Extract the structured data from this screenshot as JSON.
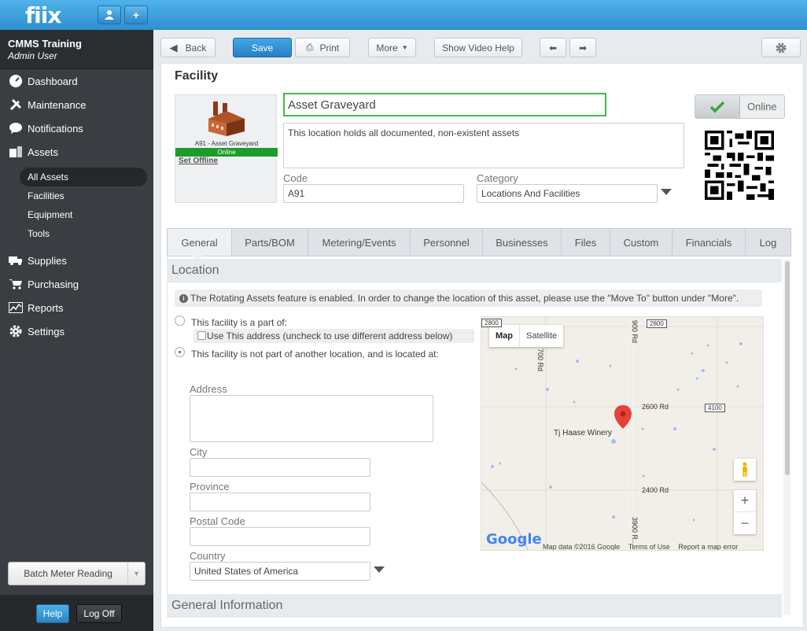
{
  "app": {
    "logo": "fiix"
  },
  "account": {
    "company": "CMMS Training",
    "role": "Admin User"
  },
  "nav": {
    "items": [
      {
        "label": "Dashboard",
        "icon": "dashboard-icon"
      },
      {
        "label": "Maintenance",
        "icon": "tools-icon"
      },
      {
        "label": "Notifications",
        "icon": "chat-bubble-icon"
      },
      {
        "label": "Assets",
        "icon": "boxes-icon"
      },
      {
        "label": "Supplies",
        "icon": "truck-icon"
      },
      {
        "label": "Purchasing",
        "icon": "cart-icon"
      },
      {
        "label": "Reports",
        "icon": "chart-icon"
      },
      {
        "label": "Settings",
        "icon": "gear-icon"
      }
    ],
    "asset_subitems": [
      "All Assets",
      "Facilities",
      "Equipment",
      "Tools"
    ],
    "batch_label": "Batch Meter Reading",
    "help_label": "Help",
    "logoff_label": "Log Off"
  },
  "toolbar": {
    "back": "Back",
    "save": "Save",
    "print": "Print",
    "more": "More",
    "video_help": "Show Video Help"
  },
  "record": {
    "type_title": "Facility",
    "name": "Asset Graveyard",
    "description": "This location holds all documented, non-existent assets",
    "thumb_caption": "A91 - Asset Graveyard",
    "thumb_status": "Online",
    "set_offline": "Set Offline",
    "code_label": "Code",
    "code": "A91",
    "category_label": "Category",
    "category": "Locations And Facilities",
    "status_toggle": "Online"
  },
  "tabs": [
    "General",
    "Parts/BOM",
    "Metering/Events",
    "Personnel",
    "Businesses",
    "Files",
    "Custom",
    "Financials",
    "Log"
  ],
  "location": {
    "heading": "Location",
    "notice": "The Rotating Assets feature is enabled. In order to change the location of this asset, please use the \"Move To\" button under \"More\".",
    "option_part_of": "This facility is a part of:",
    "use_address": "Use This address (uncheck to use different address below)",
    "option_not_part": "This facility is not part of another location, and is located at:",
    "address_label": "Address",
    "city_label": "City",
    "province_label": "Province",
    "postal_label": "Postal Code",
    "country_label": "Country",
    "country": "United States of America"
  },
  "map": {
    "type_map": "Map",
    "type_satellite": "Satellite",
    "place": "Tj Haase Winery",
    "roads": {
      "r2800a": "2800",
      "r2800b": "2800",
      "r700": "700 Rd",
      "r900": "900 Rd",
      "r2600": "2600 Rd",
      "r4100": "4100",
      "r2400": "2400 Rd",
      "r3900": "3900 R..."
    },
    "brand": "Google",
    "footer_data": "Map data ©2016 Google",
    "footer_terms": "Terms of Use",
    "footer_report": "Report a map error"
  },
  "general_info": {
    "heading": "General Information"
  },
  "colors": {
    "accent": "#2f8fd0",
    "online": "#1e9b2a",
    "name_border": "#3ebc4a"
  }
}
